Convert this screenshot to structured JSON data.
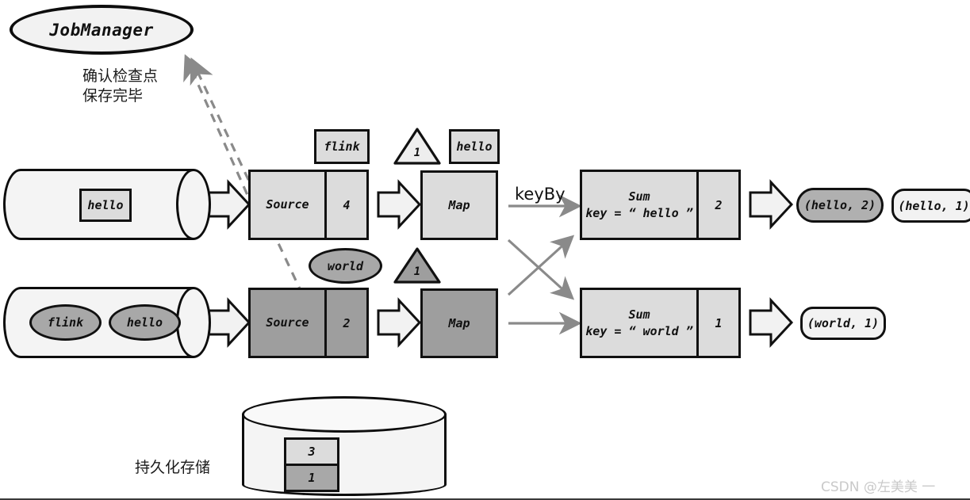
{
  "diagram": {
    "title_node": {
      "label": "JobManager"
    },
    "annotations": {
      "checkpoint_ack": "确认检查点\n保存完毕",
      "persistent_storage": "持久化存储",
      "keyby": "keyBy"
    },
    "streams": [
      {
        "name": "stream-top",
        "records": [
          {
            "kind": "rect",
            "label": "hello"
          }
        ]
      },
      {
        "name": "stream-bottom",
        "records": [
          {
            "kind": "ellipse",
            "label": "flink"
          },
          {
            "kind": "ellipse",
            "label": "hello"
          }
        ]
      }
    ],
    "inflight": {
      "top_rect": "flink",
      "top_barrier": "1",
      "post_map_rect": "hello",
      "bottom_ellipse": "world",
      "bottom_barrier": "1"
    },
    "operators": {
      "source_top": {
        "label": "Source",
        "count": "4"
      },
      "source_bottom": {
        "label": "Source",
        "count": "2"
      },
      "map_top": {
        "label": "Map"
      },
      "map_bottom": {
        "label": "Map"
      },
      "sum_top": {
        "line1": "Sum",
        "line2": "key = “ hello ”",
        "count": "2"
      },
      "sum_bottom": {
        "line1": "Sum",
        "line2": "key = “ world ”",
        "count": "1"
      }
    },
    "outputs": {
      "out_top_filled": "(hello, 2)",
      "out_top_plain": "(hello, 1)",
      "out_bottom": "(world, 1)"
    },
    "storage": {
      "cells": [
        {
          "value": "3",
          "shade": "light"
        },
        {
          "value": "1",
          "shade": "dark"
        }
      ]
    },
    "watermark": "CSDN @左美美 一",
    "colors": {
      "stroke": "#0d0d0d",
      "light_fill": "#dcdcdc",
      "dark_fill": "#9e9e9e",
      "arrow_gray": "#8a8a8a",
      "pill_filled": "#b0b0b0"
    }
  }
}
